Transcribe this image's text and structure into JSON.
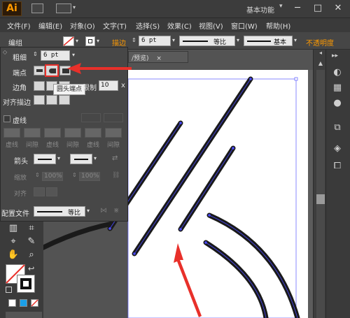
{
  "app": {
    "logo": "Ai",
    "workspace": "基本功能",
    "workspace_arrow": "▾"
  },
  "window_controls": [
    "─",
    "□",
    "✕"
  ],
  "menu": [
    "文件(F)",
    "编辑(E)",
    "对象(O)",
    "文字(T)",
    "选择(S)",
    "效果(C)",
    "视图(V)",
    "窗口(W)",
    "帮助(H)"
  ],
  "control_bar": {
    "group_label": "编组",
    "stroke_label": "描边",
    "stroke_value": "6 pt",
    "profile_label": "等比",
    "brush_label": "基本",
    "opacity_label": "不透明度"
  },
  "document_tab": {
    "label": "/预览)",
    "close": "×"
  },
  "stroke_panel": {
    "weight_label": "粗细",
    "weight_value": "6 pt",
    "cap_label": "端点",
    "corner_label": "边角",
    "limit_label": "限制",
    "limit_value": "10",
    "limit_unit": "x",
    "align_label": "对齐描边",
    "dashed_label": "虚线",
    "dash_labels": [
      "虚线",
      "间隙",
      "虚线",
      "间隙",
      "虚线",
      "间隙"
    ],
    "arrow_label": "箭头",
    "scale_label": "缩放",
    "scale_start": "100%",
    "scale_end": "100%",
    "align_arrow_label": "对齐",
    "profile_label": "配置文件",
    "profile_value": "等比"
  },
  "tooltip": "圆头端点",
  "colors": {
    "accent_red": "#e8302a",
    "stroke_line": "#1a1a1a",
    "path_highlight": "#3c3cff",
    "orange": "#ff9a00"
  }
}
